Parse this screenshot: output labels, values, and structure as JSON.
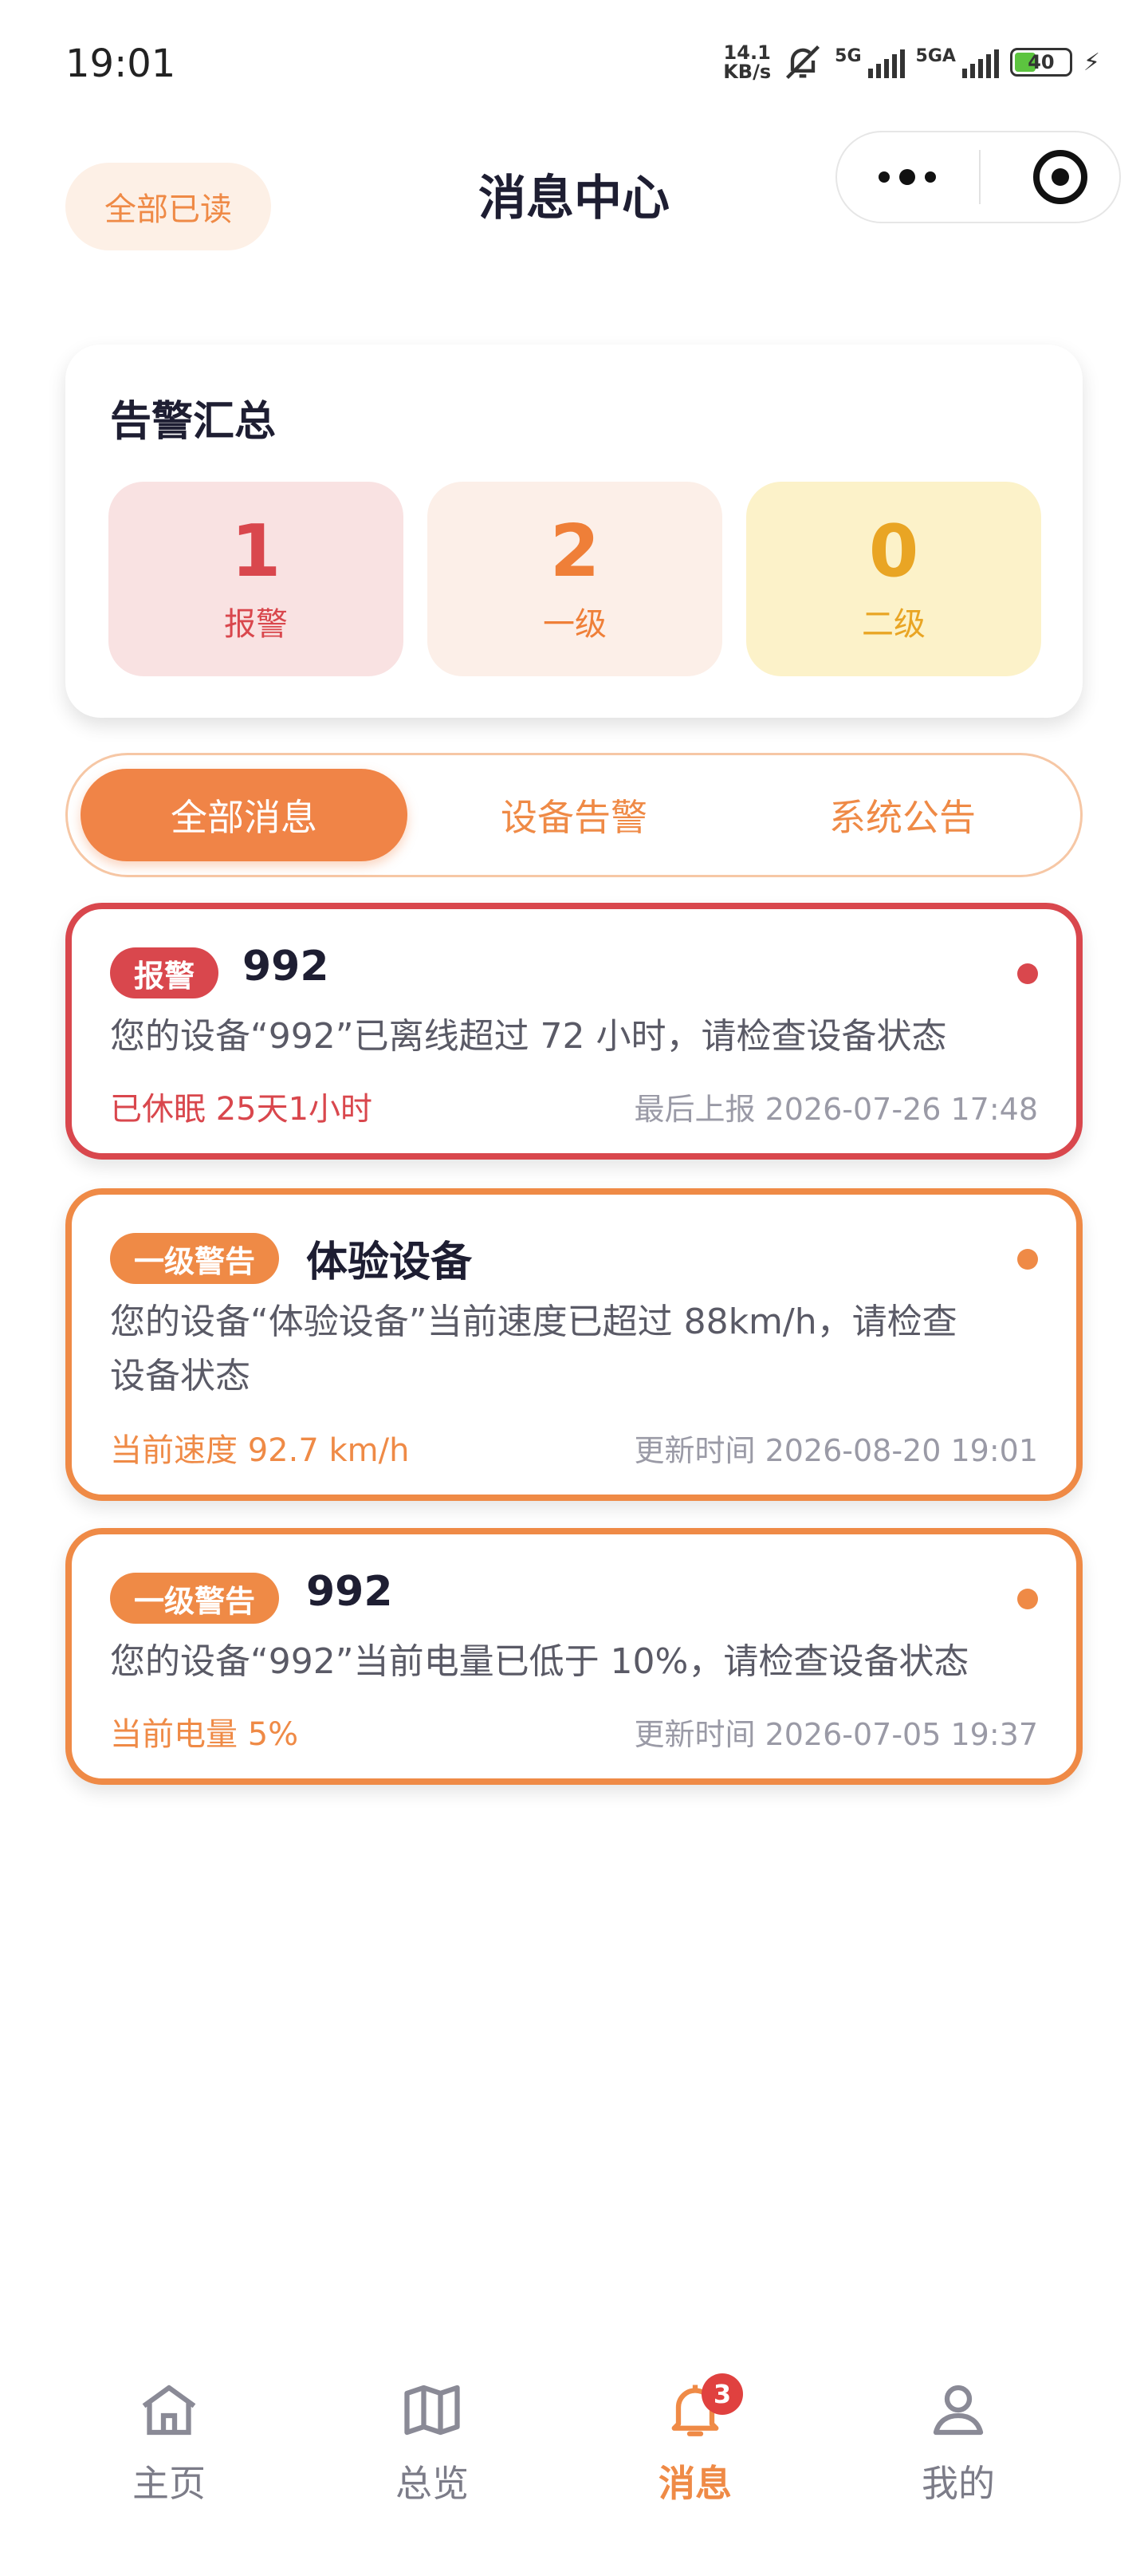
{
  "status_bar": {
    "time": "19:01",
    "net_speed_value": "14.1",
    "net_speed_unit": "KB/s",
    "signal1_label": "5G",
    "signal2_label": "5GA",
    "battery_level": "40",
    "battery_fraction": 0.4
  },
  "header": {
    "mark_all_read": "全部已读",
    "title": "消息中心"
  },
  "summary": {
    "title": "告警汇总",
    "stats": [
      {
        "count": "1",
        "label": "报警",
        "color": "#d9474d"
      },
      {
        "count": "2",
        "label": "一级",
        "color": "#ef7f38"
      },
      {
        "count": "0",
        "label": "二级",
        "color": "#e9a524"
      }
    ]
  },
  "tabs": [
    {
      "label": "全部消息",
      "active": true
    },
    {
      "label": "设备告警",
      "active": false
    },
    {
      "label": "系统公告",
      "active": false
    }
  ],
  "messages": [
    {
      "level": "报警",
      "device": "992",
      "body": "您的设备“992”已离线超过 72 小时，请检查设备状态",
      "detail": "已休眠 25天1小时",
      "time": "最后上报 2026-07-26 17:48",
      "accent": "#d9474d",
      "unread": true
    },
    {
      "level": "一级警告",
      "device": "体验设备",
      "body_line1": "您的设备“体验设备”当前速度已超过 88km/h，请检查",
      "body_line2": "设备状态",
      "detail": "当前速度 92.7 km/h",
      "time": "更新时间 2026-08-20 19:01",
      "accent": "#ef8a46",
      "unread": true
    },
    {
      "level": "一级警告",
      "device": "992",
      "body": "您的设备“992”当前电量已低于 10%，请检查设备状态",
      "detail": "当前电量 5%",
      "time": "更新时间 2026-07-05 19:37",
      "accent": "#ef8a46",
      "unread": true
    }
  ],
  "bottom_nav": [
    {
      "label": "主页",
      "icon": "home-icon",
      "active": false
    },
    {
      "label": "总览",
      "icon": "map-icon",
      "active": false
    },
    {
      "label": "消息",
      "icon": "bell-icon",
      "active": true,
      "badge": "3"
    },
    {
      "label": "我的",
      "icon": "user-icon",
      "active": false
    }
  ]
}
